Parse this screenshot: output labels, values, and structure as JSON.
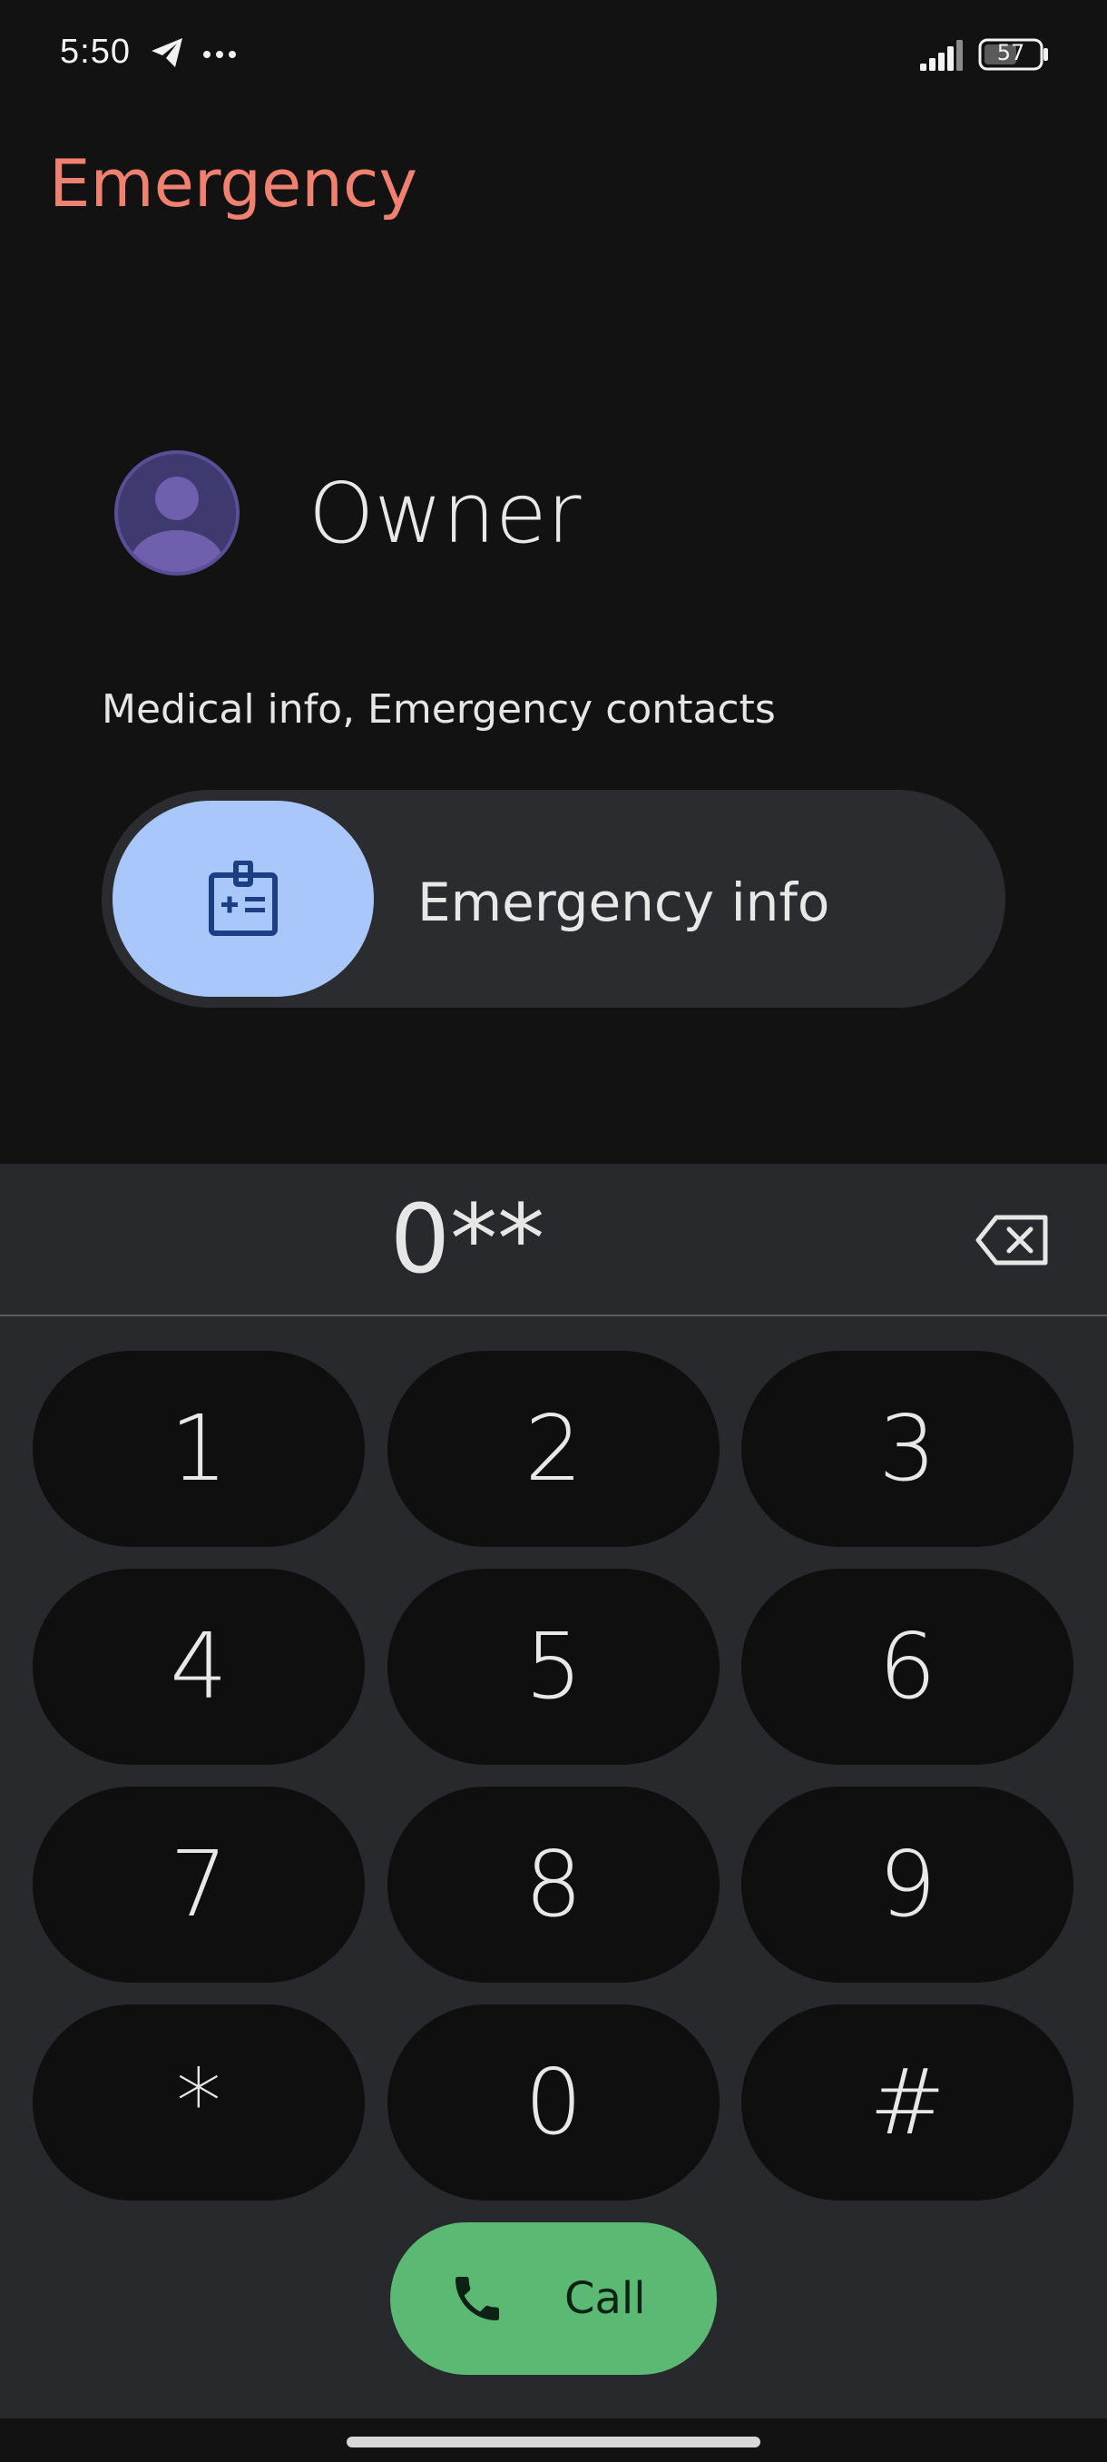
{
  "status_bar": {
    "time": "5:50",
    "battery_level": "57",
    "icons": [
      "telegram-icon",
      "more-dots-icon",
      "signal-icon",
      "battery-icon"
    ]
  },
  "header": {
    "title": "Emergency"
  },
  "owner": {
    "name": "Owner",
    "subtitle": "Medical info, Emergency contacts",
    "avatar_icon": "person-avatar-icon"
  },
  "emergency_info": {
    "label": "Emergency info",
    "icon": "medical-id-icon"
  },
  "dialer": {
    "entered_digits": "0**",
    "backspace_icon": "backspace-icon",
    "keys": [
      "1",
      "2",
      "3",
      "4",
      "5",
      "6",
      "7",
      "8",
      "9",
      "*",
      "0",
      "#"
    ],
    "call_label": "Call",
    "call_icon": "phone-icon"
  },
  "colors": {
    "title": "#f08070",
    "accent_thumb": "#aac7fb",
    "call_button": "#5bb974",
    "background": "#121212",
    "dialpad_panel": "#28292c"
  }
}
